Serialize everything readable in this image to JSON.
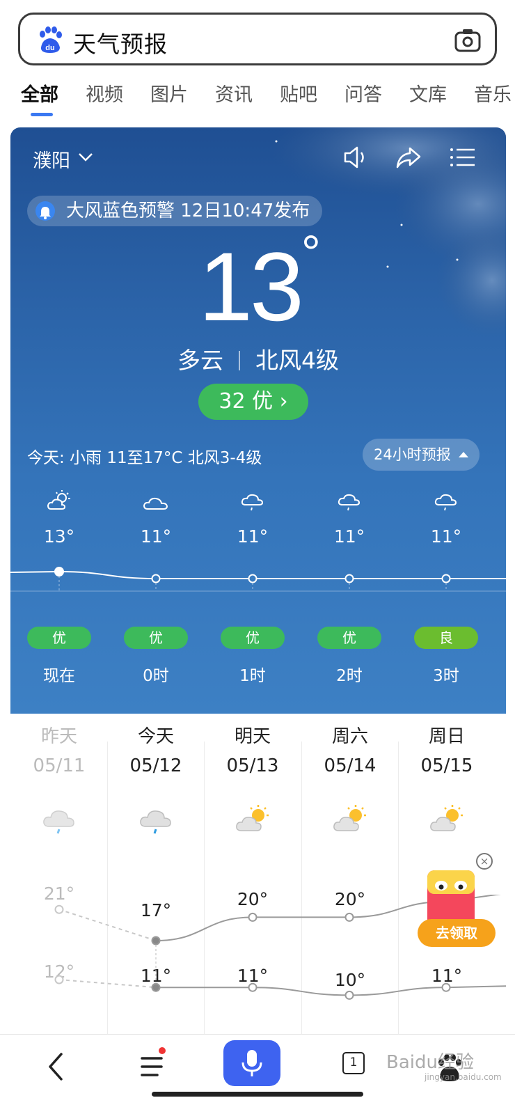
{
  "search": {
    "query": "天气预报"
  },
  "tabs": [
    {
      "label": "全部"
    },
    {
      "label": "视频"
    },
    {
      "label": "图片"
    },
    {
      "label": "资讯"
    },
    {
      "label": "贴吧"
    },
    {
      "label": "问答"
    },
    {
      "label": "文库"
    },
    {
      "label": "音乐"
    }
  ],
  "weather": {
    "city": "濮阳",
    "alert": "大风蓝色预警 12日10:47发布",
    "temperature": "13",
    "degree_symbol": "°",
    "condition": "多云",
    "wind": "北风4级",
    "aqi": "32 优",
    "aqi_arrow": "›",
    "today_summary": "今天: 小雨  11至17°C  北风3-4级",
    "forecast_24h_label": "24小时预报"
  },
  "hourly": [
    {
      "icon": "partly-cloudy-icon",
      "temp": "13°",
      "aqi": "优",
      "aqi_color": "#3dba5b",
      "label": "现在",
      "temp_value": 13
    },
    {
      "icon": "cloudy-icon",
      "temp": "11°",
      "aqi": "优",
      "aqi_color": "#3dba5b",
      "label": "0时",
      "temp_value": 11
    },
    {
      "icon": "light-rain-icon",
      "temp": "11°",
      "aqi": "优",
      "aqi_color": "#3dba5b",
      "label": "1时",
      "temp_value": 11
    },
    {
      "icon": "light-rain-icon",
      "temp": "11°",
      "aqi": "优",
      "aqi_color": "#3dba5b",
      "label": "2时",
      "temp_value": 11
    },
    {
      "icon": "light-rain-icon",
      "temp": "11°",
      "aqi": "良",
      "aqi_color": "#6bbd2f",
      "label": "3时",
      "temp_value": 11
    }
  ],
  "daily": [
    {
      "name": "昨天",
      "date": "05/11",
      "icon": "light-rain-icon",
      "high": "21°",
      "low": "12°",
      "high_value": 21,
      "low_value": 12,
      "past": true
    },
    {
      "name": "今天",
      "date": "05/12",
      "icon": "light-rain-icon",
      "high": "17°",
      "low": "11°",
      "high_value": 17,
      "low_value": 11,
      "past": false
    },
    {
      "name": "明天",
      "date": "05/13",
      "icon": "partly-cloudy-icon",
      "high": "20°",
      "low": "11°",
      "high_value": 20,
      "low_value": 11,
      "past": false
    },
    {
      "name": "周六",
      "date": "05/14",
      "icon": "partly-cloudy-icon",
      "high": "20°",
      "low": "10°",
      "high_value": 20,
      "low_value": 10,
      "past": false
    },
    {
      "name": "周日",
      "date": "05/15",
      "icon": "partly-cloudy-icon",
      "high": "",
      "low": "11°",
      "high_value": 22,
      "low_value": 11,
      "past": false
    }
  ],
  "promo": {
    "label": "去领取",
    "close": "×"
  },
  "bottom_bar": {
    "tab_count": "1"
  },
  "watermark": {
    "text": "Baidu经验",
    "sub": "jingyan.baidu.com"
  },
  "colors": {
    "accent": "#3a78f2",
    "aqi_good": "#3dba5b",
    "aqi_fair": "#6bbd2f",
    "mic": "#3e63f0",
    "promo": "#f6a21b"
  }
}
